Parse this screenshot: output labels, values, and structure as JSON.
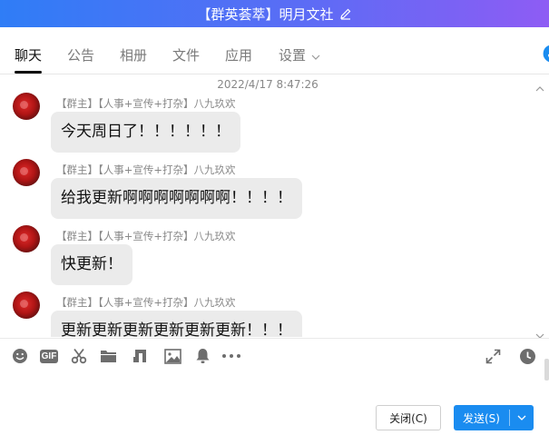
{
  "window": {
    "title": "【群英荟萃】明月文社"
  },
  "tabs": [
    {
      "label": "聊天",
      "active": true
    },
    {
      "label": "公告"
    },
    {
      "label": "相册"
    },
    {
      "label": "文件"
    },
    {
      "label": "应用"
    },
    {
      "label": "设置"
    }
  ],
  "chat": {
    "timestamp": "2022/4/17 8:47:26",
    "messages": [
      {
        "sender": "【群主】【人事+宣传+打杂】八九玖欢",
        "text": "今天周日了！！！！！！"
      },
      {
        "sender": "【群主】【人事+宣传+打杂】八九玖欢",
        "text": "给我更新啊啊啊啊啊啊啊！！！！"
      },
      {
        "sender": "【群主】【人事+宣传+打杂】八九玖欢",
        "text": "快更新！"
      },
      {
        "sender": "【群主】【人事+宣传+打杂】八九玖欢",
        "text": "更新更新更新更新更新更新！！！"
      }
    ]
  },
  "toolbar": {
    "gif_label": "GIF",
    "icons": [
      "emoji-icon",
      "gif-icon",
      "scissors-icon",
      "folder-icon",
      "music-icon",
      "image-icon",
      "bell-icon",
      "more-icon",
      "expand-icon",
      "history-icon"
    ]
  },
  "footer": {
    "close_label": "关闭(C)",
    "send_label": "发送(S)"
  },
  "colors": {
    "title_gradient_start": "#2f7df6",
    "title_gradient_end": "#8e5cf4",
    "send_button": "#1a8cf0",
    "bubble": "#ebebeb"
  }
}
